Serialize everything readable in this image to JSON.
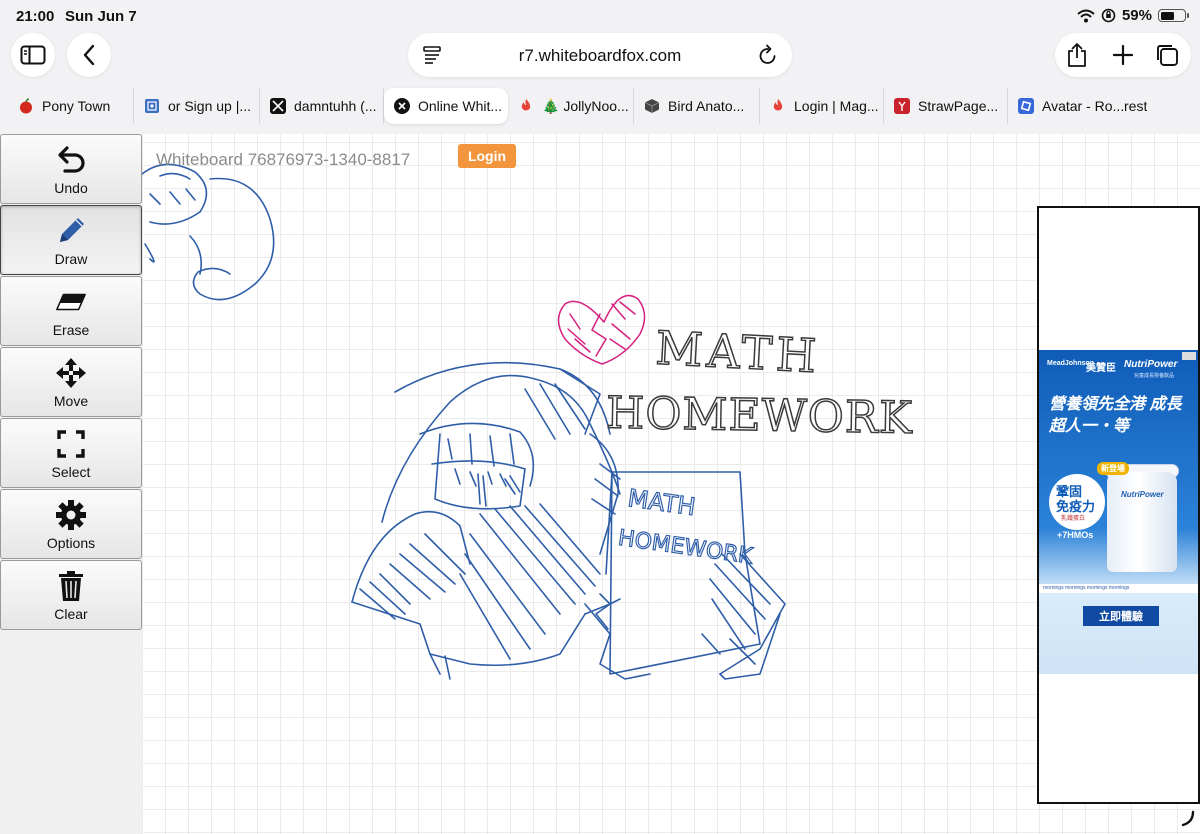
{
  "status_bar": {
    "time": "21:00",
    "date": "Sun Jun 7",
    "battery": "59%",
    "battery_level": 0.59
  },
  "browser": {
    "url": "r7.whiteboardfox.com"
  },
  "tabs": [
    {
      "label": "Pony Town",
      "icon": "apple-favicon",
      "active": false
    },
    {
      "label": "or Sign up |...",
      "icon": "pattern-favicon",
      "active": false
    },
    {
      "label": "damntuhh (...",
      "icon": "x-favicon",
      "active": false
    },
    {
      "label": "Online Whit...",
      "icon": "close-icon",
      "active": true
    },
    {
      "label": "🎄 JollyNoo...",
      "icon": "flame-favicon",
      "active": false
    },
    {
      "label": "Bird Anato...",
      "icon": "cube-favicon",
      "active": false
    },
    {
      "label": "Login | Mag...",
      "icon": "flame-favicon",
      "active": false
    },
    {
      "label": "StrawPage...",
      "icon": "strawpage-favicon",
      "active": false
    },
    {
      "label": "Avatar - Ro...",
      "icon": "roblox-favicon",
      "active": false
    },
    {
      "label": "rest",
      "icon": "",
      "active": false
    }
  ],
  "toolbox": [
    {
      "label": "Undo",
      "icon": "undo-icon",
      "selected": false
    },
    {
      "label": "Draw",
      "icon": "pencil-icon",
      "selected": true
    },
    {
      "label": "Erase",
      "icon": "eraser-icon",
      "selected": false
    },
    {
      "label": "Move",
      "icon": "move-arrows-icon",
      "selected": false
    },
    {
      "label": "Select",
      "icon": "select-frame-icon",
      "selected": false
    },
    {
      "label": "Options",
      "icon": "gear-icon",
      "selected": false
    },
    {
      "label": "Clear",
      "icon": "trash-icon",
      "selected": false
    }
  ],
  "whiteboard": {
    "title": "Whiteboard 76876973-1340-8817",
    "login_label": "Login",
    "drawing_text_large_1": "MATH",
    "drawing_text_large_2": "HOMEWORK",
    "drawing_text_small_1": "MATH",
    "drawing_text_small_2": "HOMEWORK"
  },
  "ad": {
    "brand_1": "MeadJohnson",
    "brand_2": "美贊臣",
    "brand_3": "NutriPower",
    "subtitle": "兒童成長營養飲品",
    "headline": "營養領先全港 成長超人一‧等",
    "badge": "新登場",
    "circle_line_1": "鞏固",
    "circle_line_2": "免疫力",
    "circle_line_3": "乳鐵蛋白",
    "hmo": "+7HMOs",
    "can_label": "NutriPower",
    "strip": "mornings mornings mornings mornings",
    "cta": "立即體驗"
  },
  "colors": {
    "pen_blue": "#2f5ea8",
    "heart_pink": "#d4207f",
    "text_gray": "#3a3a3a",
    "login_orange": "#f3953c"
  }
}
